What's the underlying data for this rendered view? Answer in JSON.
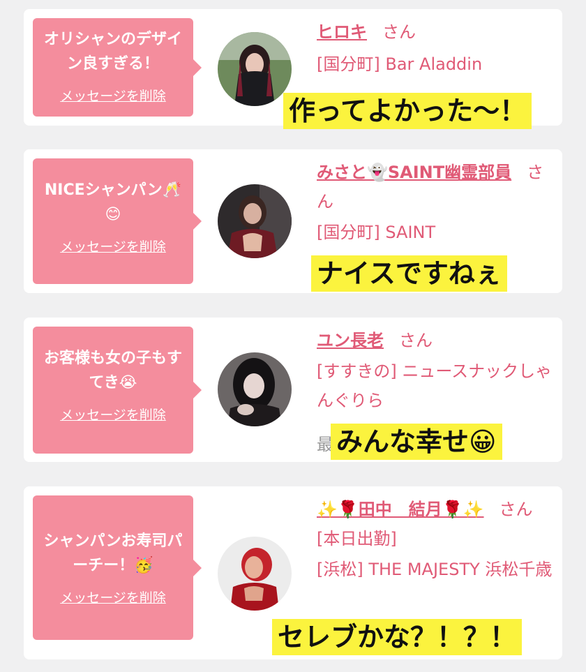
{
  "cards": [
    {
      "message": "オリシャンのデザイン良すぎる！",
      "delete_label": "メッセージを削除",
      "name": "ヒロキ",
      "suffix": "さん",
      "shop": "[国分町] Bar Aladdin",
      "caption": "作ってよかった〜！"
    },
    {
      "message": "NICEシャンパン🥂😊",
      "delete_label": "メッセージを削除",
      "name": "みさと👻SAINT幽霊部員",
      "suffix": "さん",
      "shop": "[国分町] SAINT",
      "caption": "ナイスですねぇ"
    },
    {
      "message": "お客様も女の子もすてき😭",
      "delete_label": "メッセージを削除",
      "name": "ユン長老",
      "suffix": "さん",
      "shop": "[すすきの] ニュースナックしゃんぐりら",
      "partial_text": "最",
      "caption": "みんな幸せ😀"
    },
    {
      "message": "シャンパンお寿司パーチー！🥳",
      "delete_label": "メッセージを削除",
      "name": "✨🌹田中　結月🌹✨",
      "suffix": "さん[本日出勤]",
      "shop": "[浜松] THE MAJESTY 浜松千歳",
      "caption": "セレブかな？！？！"
    }
  ],
  "colors": {
    "bubble": "#f48d9d",
    "name_text": "#e05a76",
    "caption_highlight": "#fbf33e",
    "background": "#f0f0f1"
  }
}
